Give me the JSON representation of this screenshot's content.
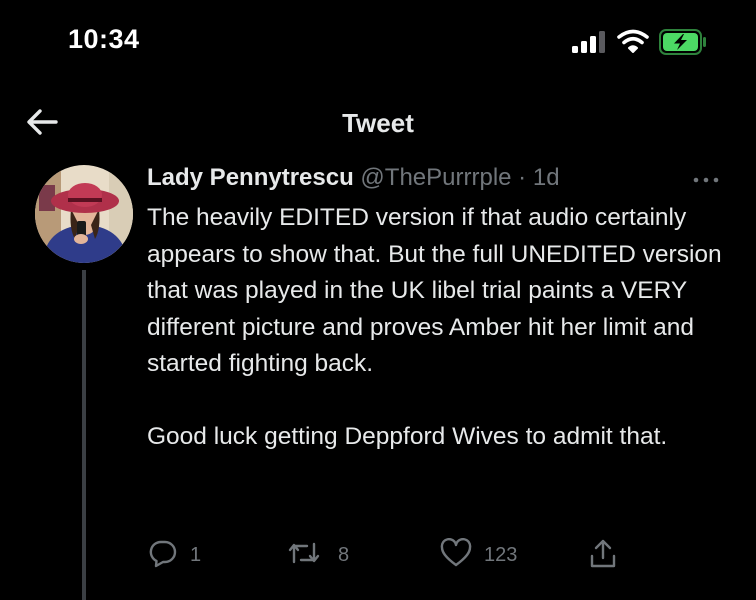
{
  "status_bar": {
    "time": "10:34",
    "icons": [
      "signal-icon",
      "wifi-icon",
      "battery-charging-icon"
    ],
    "battery_color": "#4cd964"
  },
  "header": {
    "title": "Tweet",
    "back_icon": "back-arrow-icon"
  },
  "tweet": {
    "author_name": "Lady Pennytrescu",
    "author_handle": "@ThePurrrple",
    "separator": "·",
    "time": "1d",
    "more_icon": "more-horizontal-icon",
    "paragraphs": [
      "The heavily EDITED version if that audio certainly appears to show that. But the full UNEDITED version that was played in the UK libel trial paints a VERY different picture and proves Amber hit her limit and started fighting back.",
      "Good luck getting Deppford Wives to admit that."
    ],
    "actions": {
      "reply_count": "1",
      "retweet_count": "8",
      "like_count": "123"
    }
  },
  "colors": {
    "background": "#000000",
    "text": "#e7e9ea",
    "secondary_text": "#71767b",
    "thread_line": "#3b3f44"
  }
}
